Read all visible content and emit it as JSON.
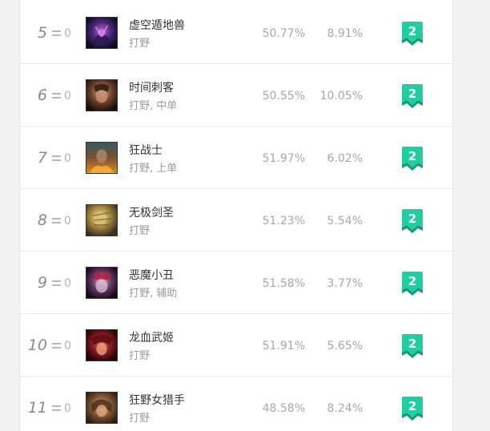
{
  "colors": {
    "tier_badge": "#1fcfa0",
    "tier_badge_dark": "#139a76",
    "rank_text": "#8a8a8a",
    "stat_text": "#a7a7a7"
  },
  "rows": [
    {
      "rank": "5",
      "change": "0",
      "name": "虚空遁地兽",
      "role": "打野",
      "win_rate": "50.77%",
      "pick_rate": "8.91%",
      "tier": "2",
      "avatar": "purple"
    },
    {
      "rank": "6",
      "change": "0",
      "name": "时间刺客",
      "role": "打野, 中单",
      "win_rate": "50.55%",
      "pick_rate": "10.05%",
      "tier": "2",
      "avatar": "brown"
    },
    {
      "rank": "7",
      "change": "0",
      "name": "狂战士",
      "role": "打野, 上单",
      "win_rate": "51.97%",
      "pick_rate": "6.02%",
      "tier": "2",
      "avatar": "fire"
    },
    {
      "rank": "8",
      "change": "0",
      "name": "无极剑圣",
      "role": "打野",
      "win_rate": "51.23%",
      "pick_rate": "5.54%",
      "tier": "2",
      "avatar": "gold"
    },
    {
      "rank": "9",
      "change": "0",
      "name": "恶魔小丑",
      "role": "打野, 辅助",
      "win_rate": "51.58%",
      "pick_rate": "3.77%",
      "tier": "2",
      "avatar": "violet"
    },
    {
      "rank": "10",
      "change": "0",
      "name": "龙血武姬",
      "role": "打野",
      "win_rate": "51.91%",
      "pick_rate": "5.65%",
      "tier": "2",
      "avatar": "red"
    },
    {
      "rank": "11",
      "change": "0",
      "name": "狂野女猎手",
      "role": "打野",
      "win_rate": "48.58%",
      "pick_rate": "8.24%",
      "tier": "2",
      "avatar": "tan"
    }
  ]
}
